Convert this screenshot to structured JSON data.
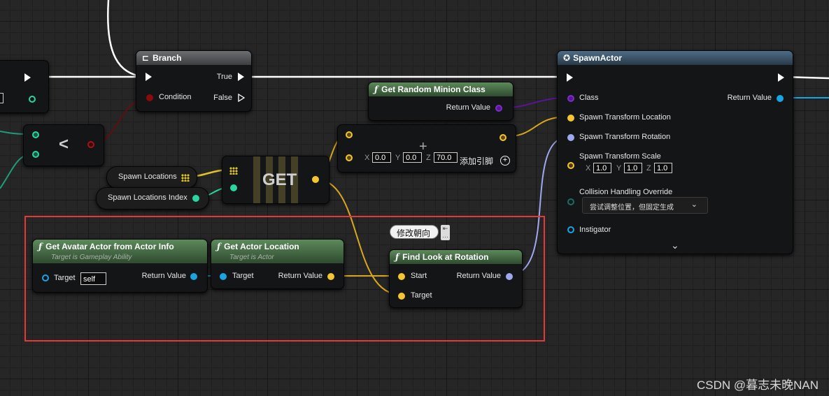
{
  "nodes": {
    "branch": {
      "title": "Branch",
      "true_label": "True",
      "false_label": "False",
      "condition_label": "Condition"
    },
    "less": {
      "op": "<"
    },
    "get_array": {
      "label": "GET"
    },
    "spawn_locations": {
      "label": "Spawn Locations"
    },
    "spawn_locations_index": {
      "label": "Spawn Locations Index"
    },
    "get_random_minion_class": {
      "title": "Get Random Minion Class",
      "return_label": "Return Value"
    },
    "make_vector": {
      "x_label": "X",
      "x_value": "0.0",
      "y_label": "Y",
      "y_value": "0.0",
      "z_label": "Z",
      "z_value": "70.0",
      "add_pin_label": "添加引脚"
    },
    "spawn_actor": {
      "title": "SpawnActor",
      "class_label": "Class",
      "return_label": "Return Value",
      "location_label": "Spawn Transform Location",
      "rotation_label": "Spawn Transform Rotation",
      "scale_label": "Spawn Transform Scale",
      "scale_x": "1.0",
      "scale_y": "1.0",
      "scale_z": "1.0",
      "x_label": "X",
      "y_label": "Y",
      "z_label": "Z",
      "collision_label": "Collision Handling Override",
      "collision_value": "尝试调整位置，但固定生成",
      "instigator_label": "Instigator"
    },
    "get_avatar_actor": {
      "title": "Get Avatar Actor from Actor Info",
      "subtitle": "Target is Gameplay Ability",
      "target_label": "Target",
      "target_value": "self",
      "return_label": "Return Value"
    },
    "get_actor_location": {
      "title": "Get Actor Location",
      "subtitle": "Target is Actor",
      "target_label": "Target",
      "return_label": "Return Value"
    },
    "find_look_at_rotation": {
      "title": "Find Look at Rotation",
      "start_label": "Start",
      "target_label": "Target",
      "return_label": "Return Value",
      "comment": "修改朝向"
    }
  },
  "watermark": "CSDN @暮志未晚NAN",
  "colors": {
    "exec": "#ffffff",
    "vector": "#f5c531",
    "rotator": "#9fa8ee",
    "object": "#1aa4e2",
    "class": "#5c139c",
    "bool": "#8c0a0a",
    "int": "#29d69f",
    "struct": "#1b6b66",
    "selection": "#e23a3a"
  }
}
